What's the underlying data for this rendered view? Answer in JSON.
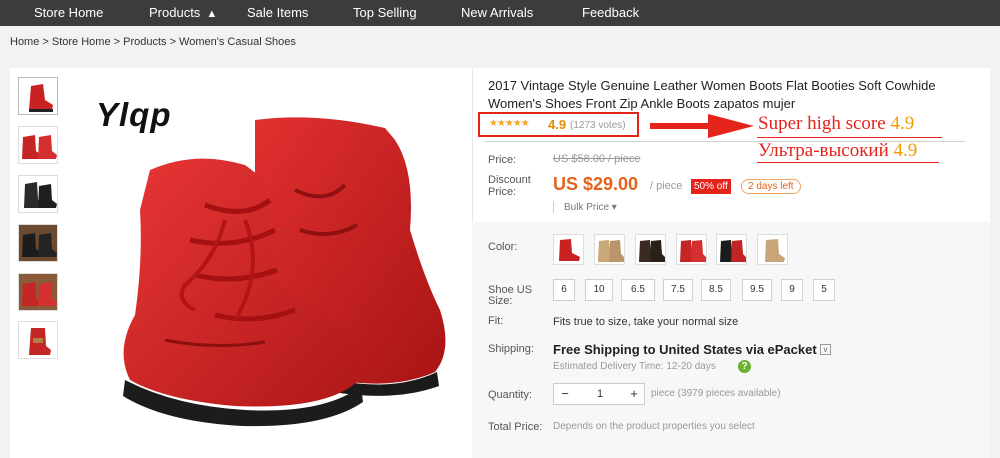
{
  "nav": {
    "items": [
      "Store Home",
      "Products",
      "Sale Items",
      "Top Selling",
      "New Arrivals",
      "Feedback"
    ],
    "products_caret": "▲"
  },
  "breadcrumb": "Home > Store Home > Products > Women's Casual Shoes",
  "brand": "Ylqp",
  "product": {
    "title": "2017 Vintage Style Genuine Leather Women Boots Flat Booties Soft Cowhide Women's Shoes Front Zip Ankle Boots zapatos mujer",
    "stars": "★★★★★",
    "rating": "4.9",
    "votes": "(1273 votes)"
  },
  "annotation": {
    "line1_text": "Super high score",
    "line1_num": "4.9",
    "line2_text": "Ультра-высокий",
    "line2_num": "4.9",
    "color": "#e4231b"
  },
  "price": {
    "price_label": "Price:",
    "old_price": "US $58.00 / piece",
    "discount_label_1": "Discount",
    "discount_label_2": "Price:",
    "discount_price": "US $29.00",
    "per_piece": "/ piece",
    "off_badge": "50% off",
    "days_left": "2 days left",
    "bulk": "Bulk Price ▾",
    "accent": "#e4631b"
  },
  "options": {
    "color_label": "Color:",
    "colors": [
      "red",
      "beige",
      "dark brown",
      "red",
      "black",
      "beige"
    ],
    "size_label_1": "Shoe US",
    "size_label_2": "Size:",
    "sizes": [
      "6",
      "10",
      "6.5",
      "7.5",
      "8.5",
      "9.5",
      "9",
      "5"
    ],
    "fit_label": "Fit:",
    "fit_value": "Fits true to size, take your normal size",
    "shipping_label": "Shipping:",
    "shipping_value": "Free Shipping to United States via ePacket",
    "estimated": "Estimated Delivery Time: 12-20 days",
    "quantity_label": "Quantity:",
    "qty_minus": "−",
    "qty_value": "1",
    "qty_plus": "+",
    "available": "piece (3979 pieces available)",
    "total_label": "Total Price:",
    "total_value": "Depends on the product properties you select"
  },
  "icons": {
    "help": "?",
    "caret": "v"
  }
}
